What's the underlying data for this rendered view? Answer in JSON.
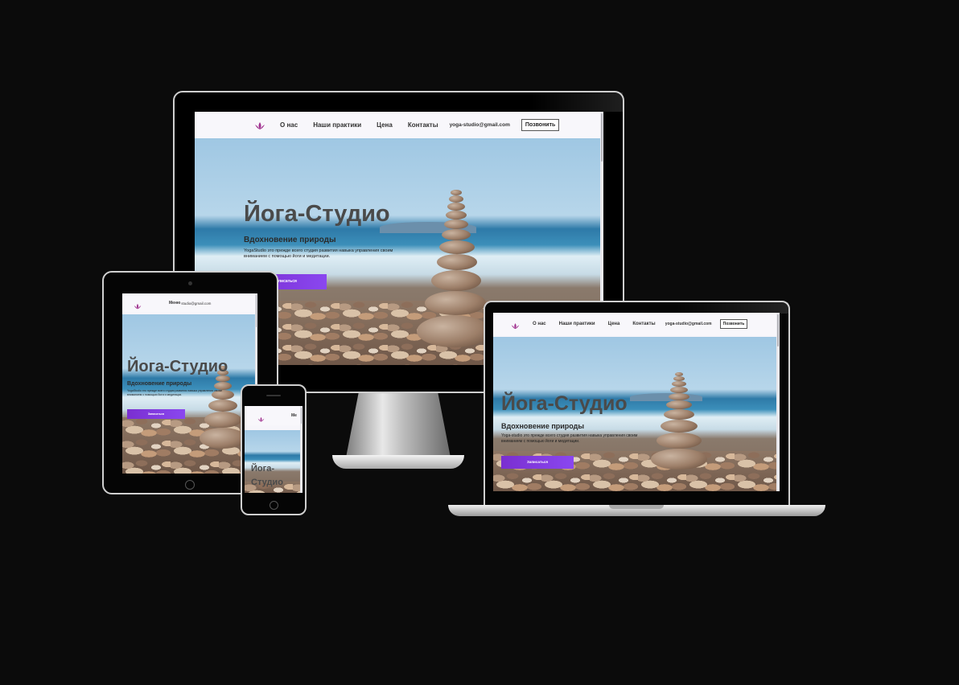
{
  "site": {
    "logo_icon": "lotus-icon",
    "nav": [
      "О нас",
      "Наши практики",
      "Цена",
      "Контакты"
    ],
    "email": "yoga-studio@gmail.com",
    "call_label": "Позвонить",
    "hero": {
      "title": "Йога-Студио",
      "subtitle": "Вдохновение природы",
      "desc_desktop": "YogaStudio это прежде всего студия развития навыка управления своим вниманием с помощью йоги и медитации.",
      "desc_laptop": "Yoga-studio это прежде всего студия развития навыка управления своим вниманием с помощью йоги и медитации.",
      "button_label": "Записаться"
    }
  },
  "tablet": {
    "nav_menu": "Меню",
    "email_partial": "studio@gmail.com"
  },
  "phone": {
    "menu_label": "Me",
    "title_line1": "Йога-",
    "title_line2": "Студио"
  },
  "colors": {
    "background": "#0b0b0b",
    "accent_button": "#7a2fd0",
    "logo": "#a0328f"
  }
}
